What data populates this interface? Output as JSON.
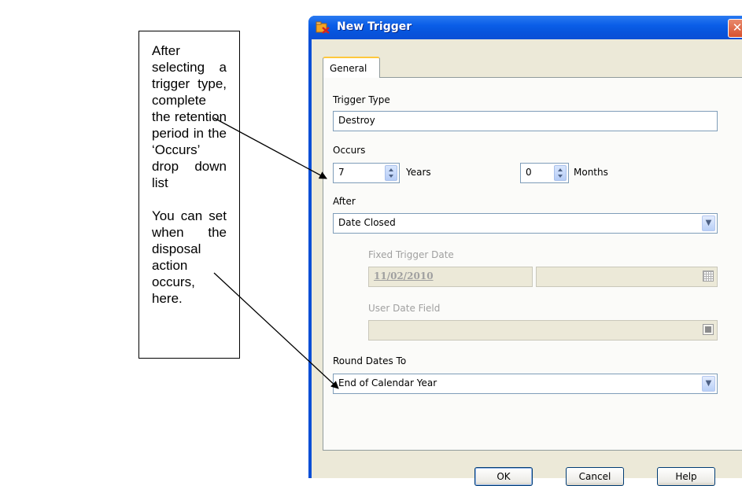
{
  "callout": {
    "paragraph_1": "After selecting a trigger type, complete the retention period in the ‘Occurs’ drop down list",
    "paragraph_2": "You can set when the disposal action occurs, here."
  },
  "window": {
    "title": "New Trigger",
    "close_glyph": "✕"
  },
  "tabs": {
    "general": "General"
  },
  "form": {
    "trigger_type_label": "Trigger Type",
    "trigger_type_value": "Destroy",
    "occurs_label": "Occurs",
    "years_value": "7",
    "years_label": "Years",
    "months_value": "0",
    "months_label": "Months",
    "after_label": "After",
    "after_value": "Date Closed",
    "fixed_date_label": "Fixed Trigger Date",
    "fixed_date_value": "11/02/2010",
    "user_date_label": "User Date Field",
    "round_label": "Round Dates To",
    "round_value": "End of Calendar Year"
  },
  "buttons": {
    "ok": "OK",
    "cancel": "Cancel",
    "help": "Help"
  },
  "icons": {
    "title": "trigger-app-icon",
    "spinner": "spin-updown-icon",
    "dropdown": "chevron-down-icon",
    "calendar": "calendar-icon",
    "field_picker": "square-picker-icon"
  },
  "colors": {
    "titlebar": "#0a5ee8",
    "dialog_bg": "#ece9d8",
    "close_button": "#d8512e",
    "tab_accent": "#ffc83c"
  }
}
